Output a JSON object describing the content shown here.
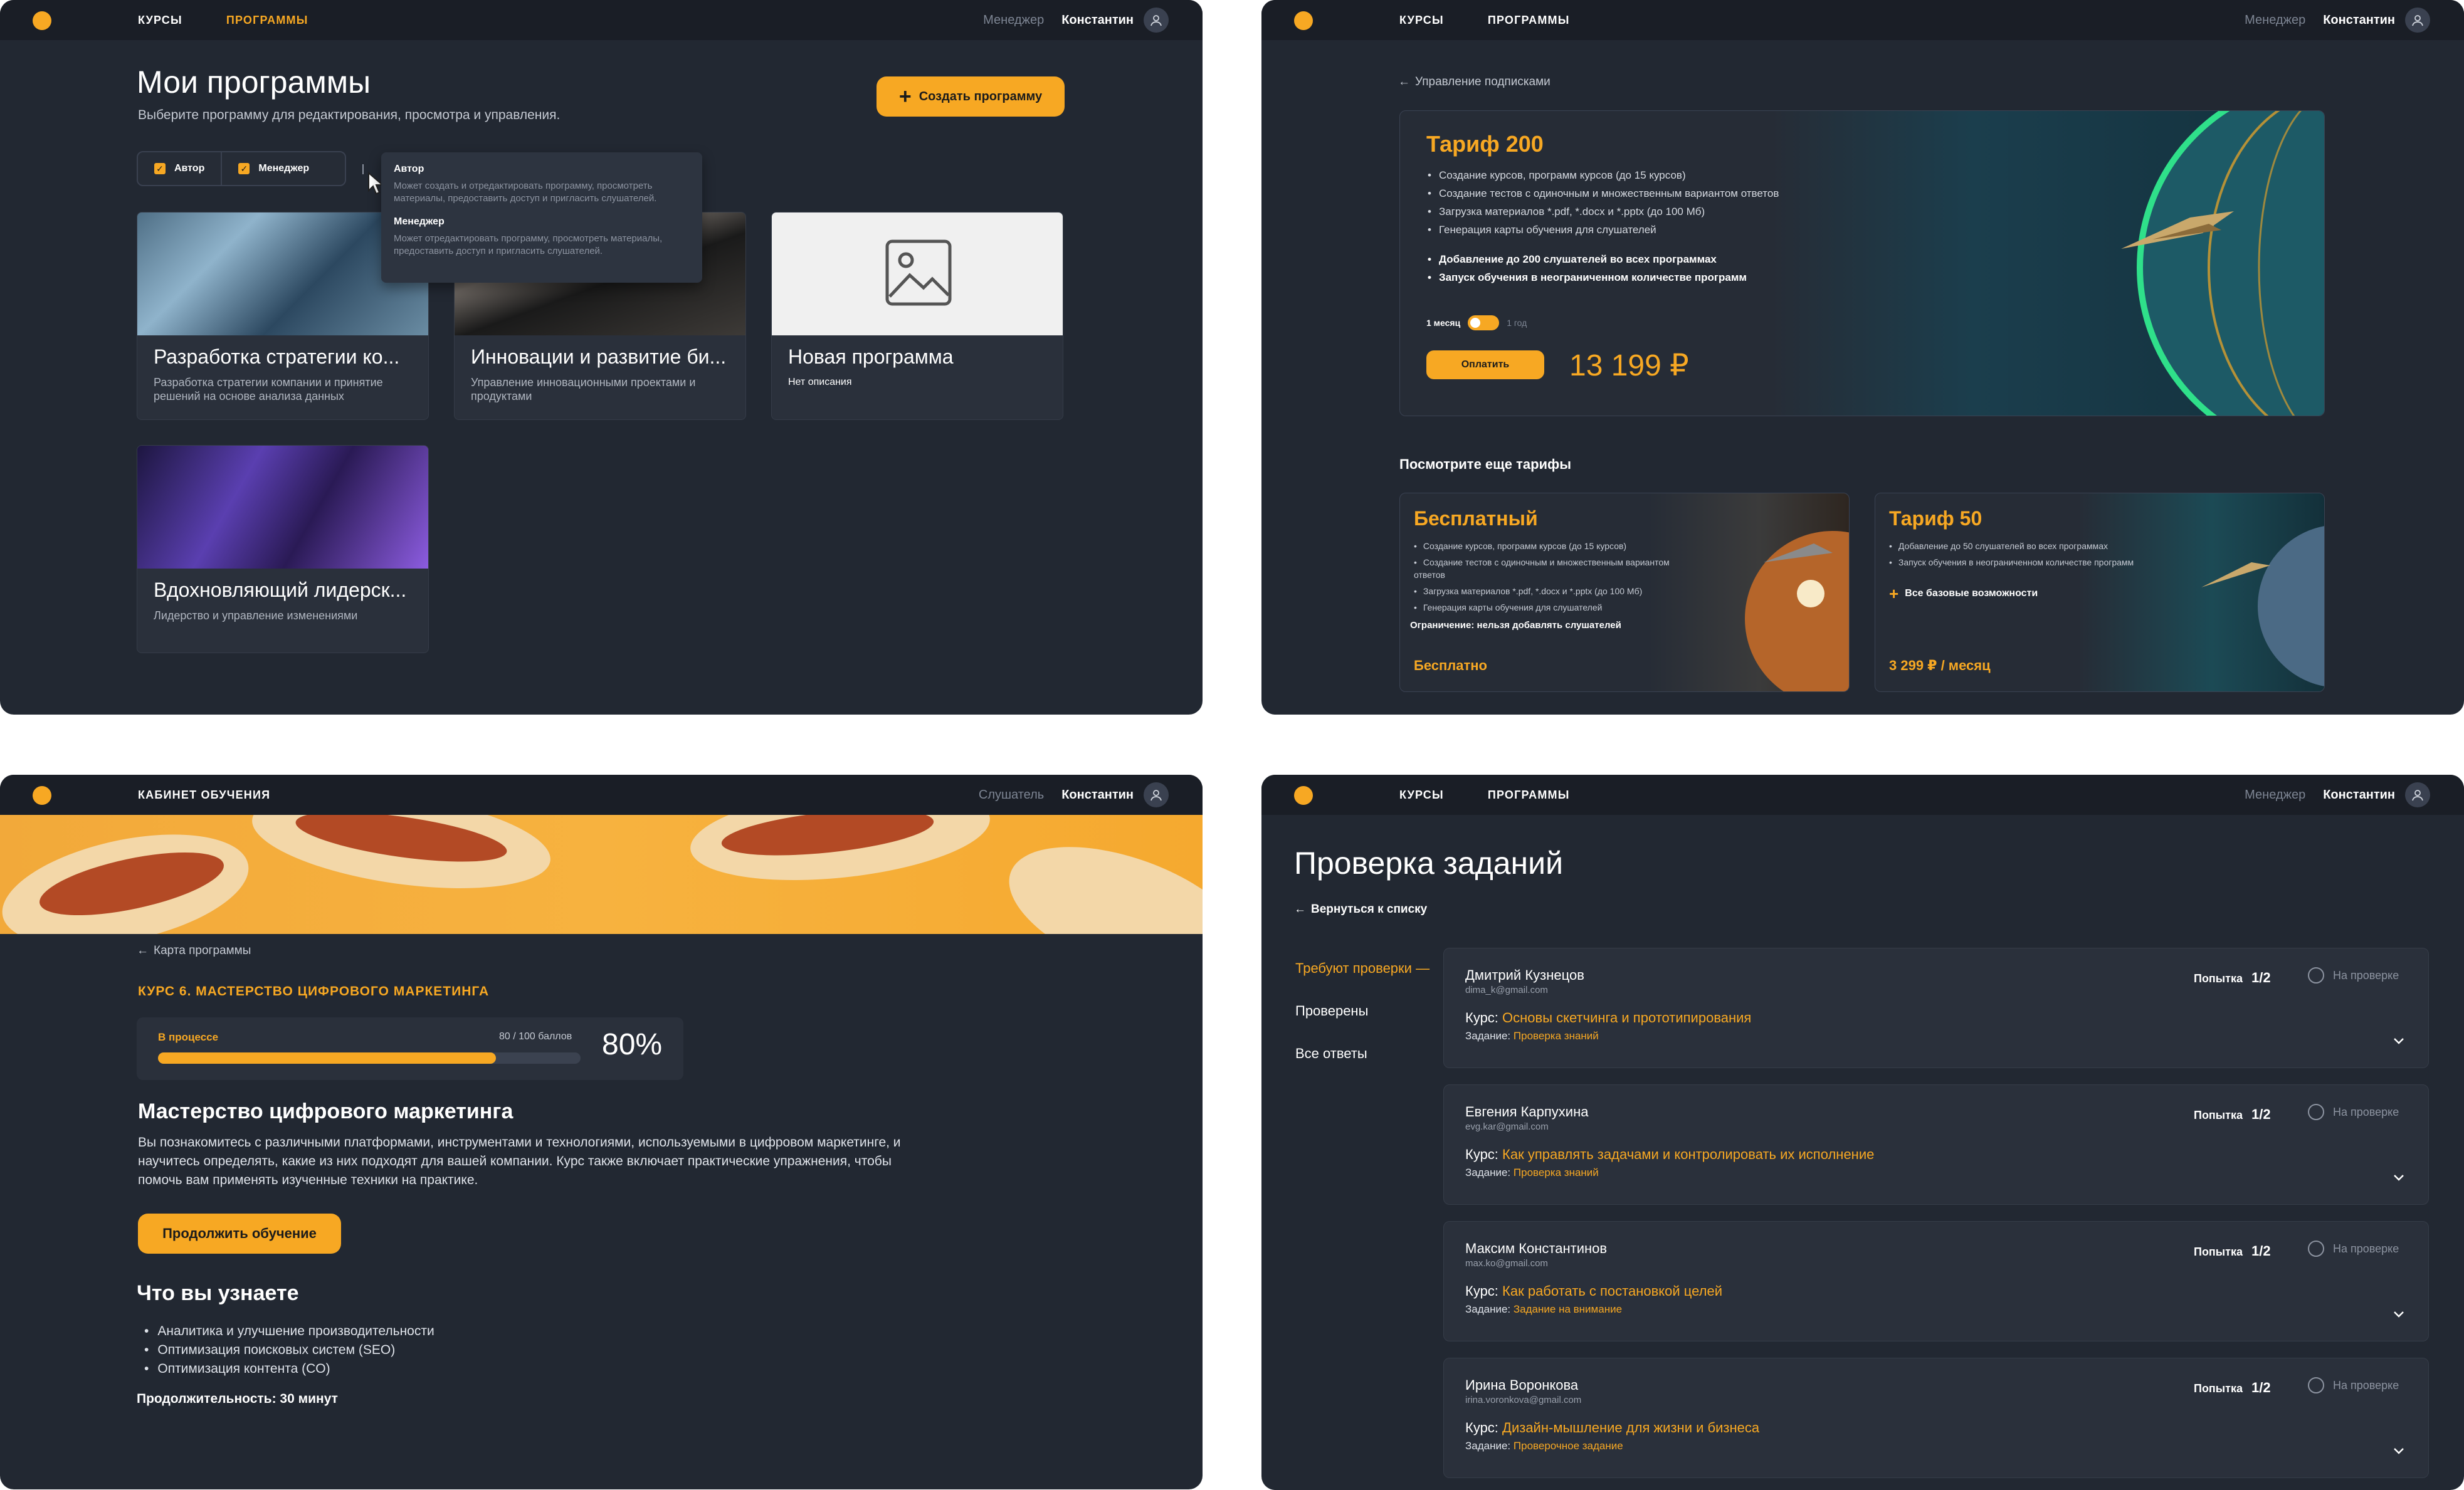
{
  "colors": {
    "accent": "#f7a823",
    "panel_bg": "#222832",
    "topbar_bg": "#1a1e26",
    "card_bg": "#2a303b"
  },
  "p1": {
    "nav": [
      "КУРСЫ",
      "ПРОГРАММЫ"
    ],
    "role": "Менеджер",
    "user": "Константин",
    "title": "Мои программы",
    "subtitle": "Выберите программу для редактирования, просмотра и управления.",
    "create_button": "Создать программу",
    "filters": [
      "Автор",
      "Менеджер"
    ],
    "tooltip": [
      {
        "title": "Автор",
        "desc": "Может создать и отредактировать программу, просмотреть материалы, предоставить доступ и пригласить слушателей."
      },
      {
        "title": "Менеджер",
        "desc": "Может отредактировать программу, просмотреть материалы, предоставить доступ и пригласить слушателей."
      }
    ],
    "cards": [
      {
        "title": "Разработка стратегии ко...",
        "desc": "Разработка стратегии компании и принятие решений на основе анализа данных"
      },
      {
        "title": "Инновации и развитие би...",
        "desc": "Управление инновационными проектами и продуктами"
      },
      {
        "title": "Новая программа",
        "desc": "Нет описания"
      },
      {
        "title": "Вдохновляющий лидерск...",
        "desc": "Лидерство и управление изменениями"
      }
    ]
  },
  "p2": {
    "nav": [
      "КУРСЫ",
      "ПРОГРАММЫ"
    ],
    "role": "Менеджер",
    "user": "Константин",
    "back": "Управление подписками",
    "main_tariff": {
      "title": "Тариф 200",
      "features": [
        "Создание курсов, программ курсов (до 15 курсов)",
        "Создание тестов с одиночным и множественным вариантом ответов",
        "Загрузка материалов *.pdf, *.docx и *.pptx (до 100 Мб)",
        "Генерация карты обучения для слушателей"
      ],
      "highlights": [
        "Добавление до 200 слушателей во всех программах",
        "Запуск обучения в неограниченном количестве программ"
      ],
      "toggle_left": "1 месяц",
      "toggle_right": "1 год",
      "pay_button": "Оплатить",
      "price": "13 199 ₽"
    },
    "more_title": "Посмотрите еще тарифы",
    "free": {
      "title": "Бесплатный",
      "features": [
        "Создание курсов, программ курсов (до 15 курсов)",
        "Создание тестов с одиночным и множественным вариантом ответов",
        "Загрузка материалов *.pdf, *.docx и *.pptx (до 100 Мб)",
        "Генерация карты обучения для слушателей"
      ],
      "limit": "Ограничение: нельзя добавлять слушателей",
      "price": "Бесплатно"
    },
    "t50": {
      "title": "Тариф 50",
      "features": [
        "Добавление до 50 слушателей во всех программах",
        "Запуск обучения в неограниченном количестве программ"
      ],
      "plus": "Все базовые возможности",
      "price": "3 299 ₽ / месяц"
    }
  },
  "p3": {
    "nav_title": "КАБИНЕТ ОБУЧЕНИЯ",
    "role": "Слушатель",
    "user": "Константин",
    "back": "Карта программы",
    "course_label": "КУРС 6. МАСТЕРСТВО ЦИФРОВОГО МАРКЕТИНГА",
    "status": "В процессе",
    "score": "80 / 100 баллов",
    "percent": "80%",
    "progress": 0.8,
    "title": "Мастерство цифрового маркетинга",
    "description": "Вы познакомитесь с различными платформами, инструментами и технологиями, используемыми в цифровом маркетинге, и научитесь определять, какие из них подходят для вашей компании. Курс также включает практические упражнения, чтобы помочь вам применять изученные техники на практике.",
    "continue_button": "Продолжить обучение",
    "learn_title": "Что вы узнаете",
    "learn_items": [
      "Аналитика и улучшение производительности",
      "Оптимизация поисковых систем (SEO)",
      "Оптимизация контента (CO)"
    ],
    "duration": "Продолжительность: 30 минут"
  },
  "p4": {
    "nav": [
      "КУРСЫ",
      "ПРОГРАММЫ"
    ],
    "role": "Менеджер",
    "user": "Константин",
    "title": "Проверка заданий",
    "back": "Вернуться к списку",
    "sidebar": [
      "Требуют проверки —",
      "Проверены",
      "Все ответы"
    ],
    "attempt_label": "Попытка",
    "status_label": "На проверке",
    "course_prefix": "Курс:",
    "task_prefix": "Задание:",
    "tasks": [
      {
        "name": "Дмитрий Кузнецов",
        "email": "dima_k@gmail.com",
        "attempt": "1/2",
        "course": "Основы скетчинга и прототипирования",
        "task": "Проверка знаний"
      },
      {
        "name": "Евгения Карпухина",
        "email": "evg.kar@gmail.com",
        "attempt": "1/2",
        "course": "Как управлять задачами и контролировать их исполнение",
        "task": "Проверка знаний"
      },
      {
        "name": "Максим Константинов",
        "email": "max.ko@gmail.com",
        "attempt": "1/2",
        "course": "Как работать с постановкой целей",
        "task": "Задание на внимание"
      },
      {
        "name": "Ирина Воронкова",
        "email": "irina.voronkova@gmail.com",
        "attempt": "1/2",
        "course": "Дизайн-мышление для жизни и бизнеса",
        "task": "Проверочное задание"
      }
    ]
  }
}
